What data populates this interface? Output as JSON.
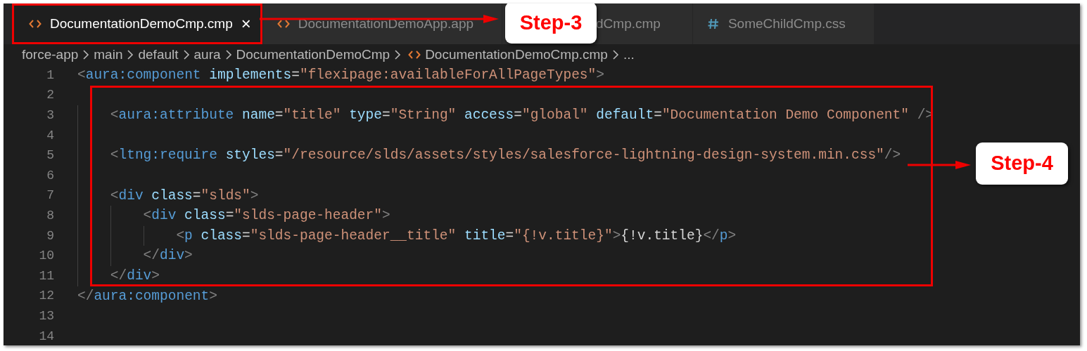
{
  "tabs": [
    {
      "label": "DocumentationDemoCmp.cmp",
      "kind": "markup",
      "selected": true,
      "highlighted": true,
      "close": "×"
    },
    {
      "label": "DocumentationDemoApp.app",
      "kind": "markup",
      "selected": false,
      "highlighted": false
    },
    {
      "label": "dCmp.cmp",
      "kind": "covered",
      "selected": false,
      "highlighted": false
    },
    {
      "label": "SomeChildCmp.css",
      "kind": "css",
      "selected": false,
      "highlighted": false
    }
  ],
  "tab_callout": {
    "label": "Step-3"
  },
  "breadcrumbs": [
    {
      "label": "force-app",
      "kind": "folder"
    },
    {
      "label": "main",
      "kind": "folder"
    },
    {
      "label": "default",
      "kind": "folder"
    },
    {
      "label": "aura",
      "kind": "folder"
    },
    {
      "label": "DocumentationDemoCmp",
      "kind": "folder"
    },
    {
      "label": "DocumentationDemoCmp.cmp",
      "kind": "markup"
    },
    {
      "label": "...",
      "kind": "folder"
    }
  ],
  "code_sections": [
    {
      "highlighted": false,
      "lines": [
        {
          "number": "1",
          "tokens": [
            {
              "kind": "punct",
              "text": "<"
            },
            {
              "kind": "tag",
              "text": "aura:component"
            },
            {
              "kind": "attr",
              "text": " implements"
            },
            {
              "kind": "text",
              "text": "="
            },
            {
              "kind": "string",
              "text": "\"flexipage:availableForAllPageTypes\""
            },
            {
              "kind": "punct",
              "text": ">"
            }
          ]
        }
      ]
    },
    {
      "highlighted": true,
      "lines": [
        {
          "number": "2"
        },
        {
          "number": "3",
          "tokens": [
            {
              "kind": "punct",
              "text": "    <"
            },
            {
              "kind": "tag",
              "text": "aura:attribute"
            },
            {
              "kind": "attr",
              "text": " name"
            },
            {
              "kind": "text",
              "text": "="
            },
            {
              "kind": "string",
              "text": "\"title\""
            },
            {
              "kind": "attr",
              "text": " type"
            },
            {
              "kind": "text",
              "text": "="
            },
            {
              "kind": "string",
              "text": "\"String\""
            },
            {
              "kind": "attr",
              "text": " access"
            },
            {
              "kind": "text",
              "text": "="
            },
            {
              "kind": "string",
              "text": "\"global\""
            },
            {
              "kind": "attr",
              "text": " default"
            },
            {
              "kind": "text",
              "text": "="
            },
            {
              "kind": "string",
              "text": "\"Documentation Demo Component\""
            },
            {
              "kind": "punct",
              "text": " />"
            }
          ]
        },
        {
          "number": "4"
        },
        {
          "number": "5",
          "tokens": [
            {
              "kind": "punct",
              "text": "    <"
            },
            {
              "kind": "tag",
              "text": "ltng:require"
            },
            {
              "kind": "attr",
              "text": " styles"
            },
            {
              "kind": "text",
              "text": "="
            },
            {
              "kind": "string",
              "text": "\"/resource/slds/assets/styles/salesforce-lightning-design-system.min.css\""
            },
            {
              "kind": "punct",
              "text": "/>"
            }
          ]
        },
        {
          "number": "6"
        },
        {
          "number": "7",
          "tokens": [
            {
              "kind": "punct",
              "text": "    <"
            },
            {
              "kind": "tag",
              "text": "div"
            },
            {
              "kind": "attr",
              "text": " class"
            },
            {
              "kind": "text",
              "text": "="
            },
            {
              "kind": "string",
              "text": "\"slds\""
            },
            {
              "kind": "punct",
              "text": ">"
            }
          ]
        },
        {
          "number": "8",
          "tokens": [
            {
              "kind": "punct",
              "text": "        <"
            },
            {
              "kind": "tag",
              "text": "div"
            },
            {
              "kind": "attr",
              "text": " class"
            },
            {
              "kind": "text",
              "text": "="
            },
            {
              "kind": "string",
              "text": "\"slds-page-header\""
            },
            {
              "kind": "punct",
              "text": ">"
            }
          ]
        },
        {
          "number": "9",
          "tokens": [
            {
              "kind": "punct",
              "text": "            <"
            },
            {
              "kind": "tag",
              "text": "p"
            },
            {
              "kind": "attr",
              "text": " class"
            },
            {
              "kind": "text",
              "text": "="
            },
            {
              "kind": "string",
              "text": "\"slds-page-header__title\""
            },
            {
              "kind": "attr",
              "text": " title"
            },
            {
              "kind": "text",
              "text": "="
            },
            {
              "kind": "string",
              "text": "\"{!v.title}\""
            },
            {
              "kind": "punct",
              "text": ">"
            },
            {
              "kind": "text",
              "text": "{!v.title}"
            },
            {
              "kind": "punct",
              "text": "</"
            },
            {
              "kind": "tag",
              "text": "p"
            },
            {
              "kind": "punct",
              "text": ">"
            }
          ]
        },
        {
          "number": "10",
          "tokens": [
            {
              "kind": "punct",
              "text": "        </"
            },
            {
              "kind": "tag",
              "text": "div"
            },
            {
              "kind": "punct",
              "text": ">"
            }
          ]
        },
        {
          "number": "11",
          "tokens": [
            {
              "kind": "punct",
              "text": "    </"
            },
            {
              "kind": "tag",
              "text": "div"
            },
            {
              "kind": "punct",
              "text": ">"
            }
          ]
        }
      ]
    },
    {
      "highlighted": false,
      "lines": [
        {
          "number": "12",
          "tokens": [
            {
              "kind": "punct",
              "text": "</"
            },
            {
              "kind": "tag",
              "text": "aura:component"
            },
            {
              "kind": "punct",
              "text": ">"
            }
          ]
        },
        {
          "number": "13"
        },
        {
          "number": "14"
        }
      ]
    }
  ],
  "code_callout": {
    "label": "Step-4"
  }
}
